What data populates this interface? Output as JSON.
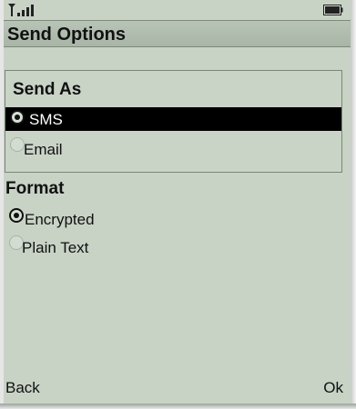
{
  "status": {
    "signal_icon": "antenna-signal-icon",
    "battery_icon": "battery-icon"
  },
  "title": "Send Options",
  "send_as": {
    "title": "Send As",
    "options": [
      {
        "label": "SMS",
        "selected": true
      },
      {
        "label": "Email",
        "selected": false
      }
    ]
  },
  "format": {
    "title": "Format",
    "options": [
      {
        "label": "Encrypted",
        "selected": true
      },
      {
        "label": "Plain Text",
        "selected": false
      }
    ]
  },
  "softkeys": {
    "left": "Back",
    "right": "Ok"
  },
  "colors": {
    "screen_bg": "#c8d3c6",
    "title_bar_bg": "#b0bcae",
    "highlight_bg": "#000000",
    "highlight_text": "#ffffff"
  }
}
